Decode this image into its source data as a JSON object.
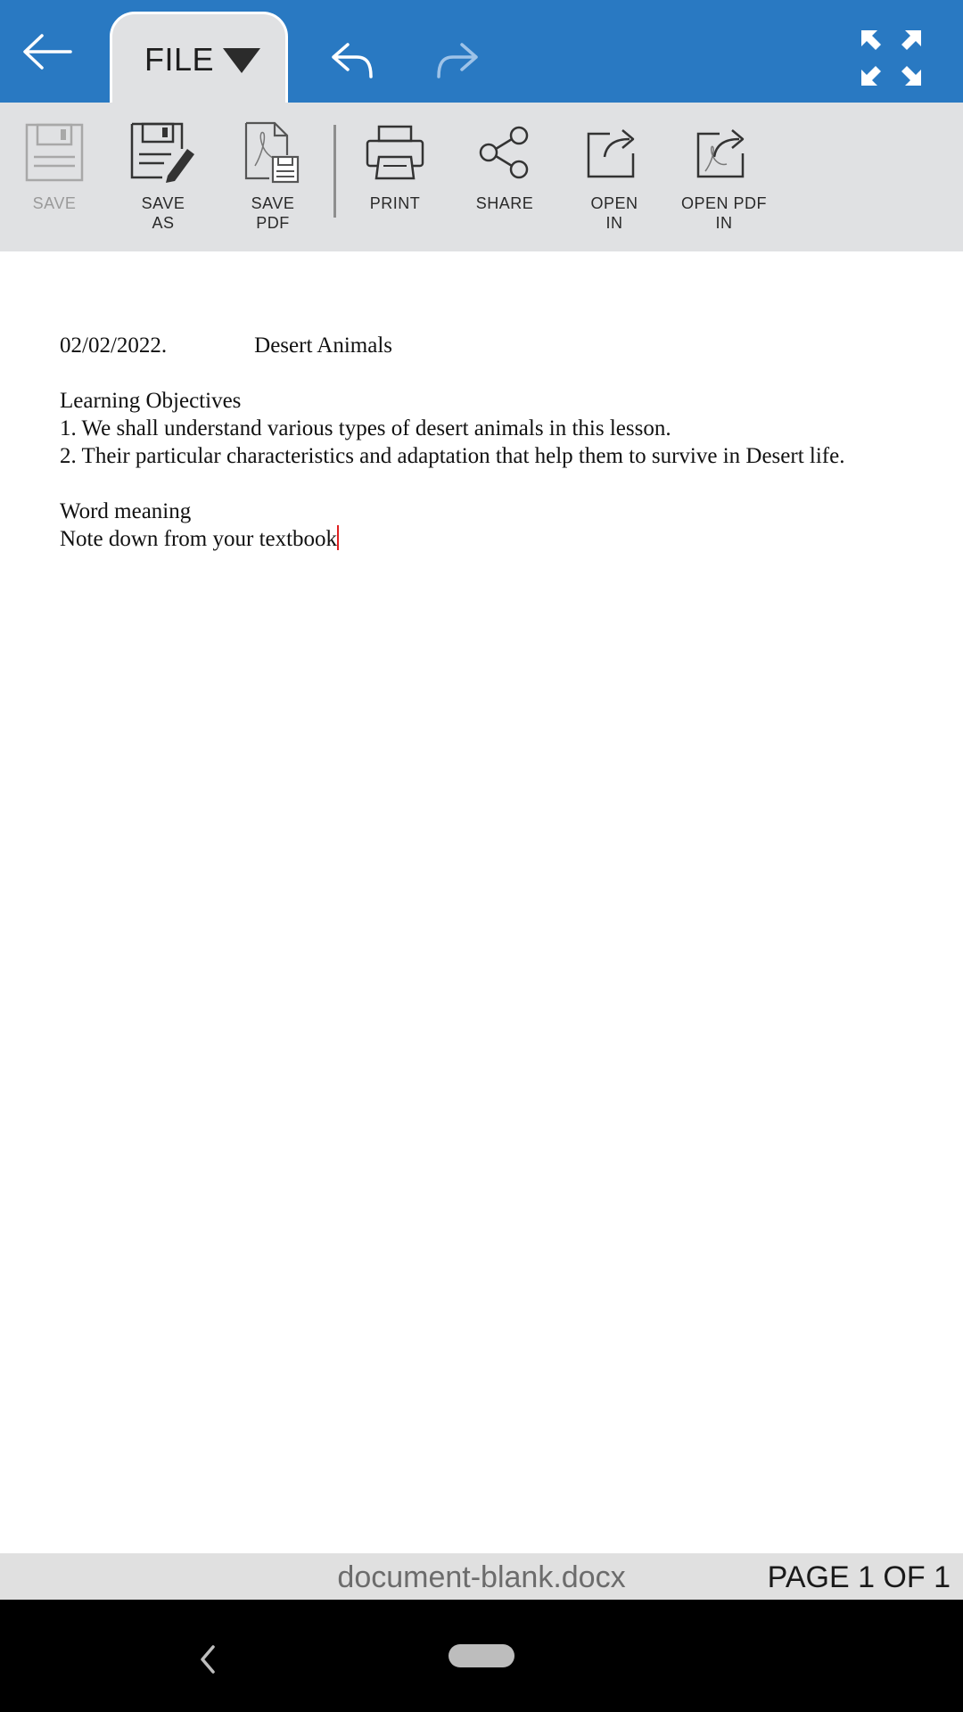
{
  "header": {
    "file_tab_label": "FILE"
  },
  "toolbar": {
    "items": [
      {
        "label": "SAVE",
        "icon": "floppy-disk-icon",
        "enabled": false
      },
      {
        "label": "SAVE\nAS",
        "icon": "save-as-pencil-icon",
        "enabled": true
      },
      {
        "label": "SAVE\nPDF",
        "icon": "save-pdf-icon",
        "enabled": true
      },
      {
        "label": "PRINT",
        "icon": "printer-icon",
        "enabled": true
      },
      {
        "label": "SHARE",
        "icon": "share-icon",
        "enabled": true
      },
      {
        "label": "OPEN\nIN",
        "icon": "open-in-icon",
        "enabled": true
      },
      {
        "label": "OPEN PDF\nIN",
        "icon": "open-pdf-in-icon",
        "enabled": true
      }
    ]
  },
  "document": {
    "date": "02/02/2022.",
    "title": "Desert Animals",
    "heading": "Learning Objectives",
    "objective_1": "1. We shall understand various types of desert animals in this lesson.",
    "objective_2": "2. Their particular characteristics and adaptation that help them to survive in Desert life.",
    "section_2": "Word meaning",
    "note": "Note down from your textbook"
  },
  "status": {
    "filename": "document-blank.docx",
    "page_indicator": "PAGE 1 OF 1"
  },
  "colors": {
    "header_blue": "#2979c2",
    "ribbon_gray": "#e0e1e3",
    "cursor_red": "#e02020"
  }
}
